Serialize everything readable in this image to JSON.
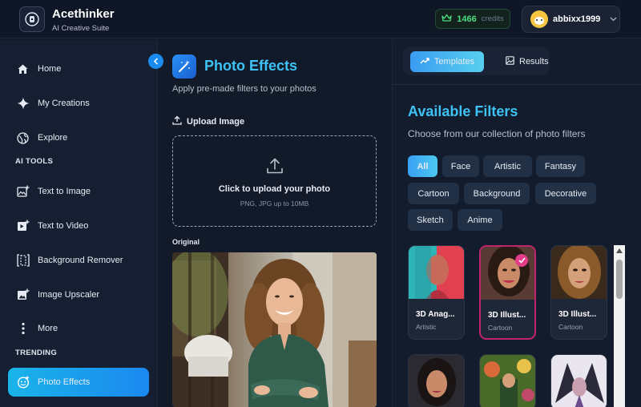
{
  "header": {
    "app_title": "Acethinker",
    "app_subtitle": "AI Creative Suite",
    "credits_value": "1466",
    "credits_label": "credits",
    "username": "abbixx1999"
  },
  "sidebar": {
    "items": [
      {
        "label": "Home",
        "icon": "home-icon"
      },
      {
        "label": "My Creations",
        "icon": "sparkle-icon"
      },
      {
        "label": "Explore",
        "icon": "globe-icon"
      }
    ],
    "ai_tools_label": "AI TOOLS",
    "ai_tools": [
      {
        "label": "Text to Image",
        "icon": "image-plus-icon"
      },
      {
        "label": "Text to Video",
        "icon": "video-plus-icon"
      },
      {
        "label": "Background Remover",
        "icon": "crop-icon"
      },
      {
        "label": "Image Upscaler",
        "icon": "image-upscale-icon"
      },
      {
        "label": "More",
        "icon": "more-vertical-icon"
      }
    ],
    "trending_label": "TRENDING",
    "trending": [
      {
        "label": "Photo Effects",
        "icon": "photo-effects-icon",
        "active": true
      }
    ]
  },
  "middle": {
    "title": "Photo Effects",
    "subtitle": "Apply pre-made filters to your photos",
    "upload_label": "Upload Image",
    "dropzone_main": "Click to upload your photo",
    "dropzone_sub": "PNG, JPG up to 10MB",
    "original_label": "Original"
  },
  "right": {
    "tabs": [
      {
        "label": "Templates",
        "active": true
      },
      {
        "label": "Results",
        "active": false
      }
    ],
    "title": "Available Filters",
    "subtitle": "Choose from our collection of photo filters",
    "categories": [
      "All",
      "Face",
      "Artistic",
      "Fantasy",
      "Cartoon",
      "Background",
      "Decorative",
      "Sketch",
      "Anime"
    ],
    "selected_category": "All",
    "filters": [
      {
        "name": "3D Anag...",
        "category": "Artistic",
        "selected": false
      },
      {
        "name": "3D Illust...",
        "category": "Cartoon",
        "selected": true
      },
      {
        "name": "3D Illust...",
        "category": "Cartoon",
        "selected": false
      }
    ]
  },
  "colors": {
    "accent_cyan": "#3ec2f5",
    "accent_blue": "#1b88f0",
    "credits_green": "#4ade80",
    "selected_border": "#c0246a"
  }
}
